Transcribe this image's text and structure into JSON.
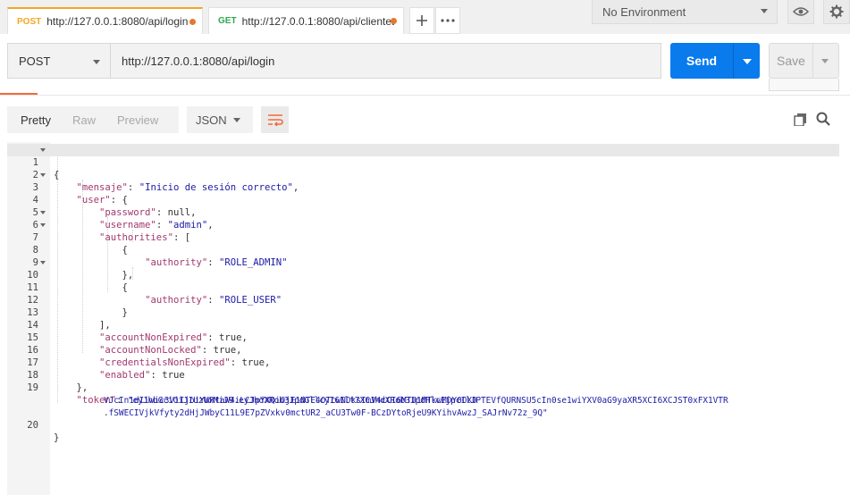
{
  "tabs": [
    {
      "method": "POST",
      "method_color": "#f5a623",
      "url": "http://127.0.0.1:8080/api/login",
      "active": true,
      "unsaved": true
    },
    {
      "method": "GET",
      "method_color": "#2fa84f",
      "url": "http://127.0.0.1:8080/api/clientes",
      "active": false,
      "unsaved": true
    }
  ],
  "tab_actions": {
    "add_icon": "plus-icon",
    "more_icon": "ellipsis-icon"
  },
  "environment": {
    "selected": "No Environment",
    "eye_icon": "eye-icon",
    "settings_icon": "gear-icon"
  },
  "request": {
    "method": "POST",
    "url": "http://127.0.0.1:8080/api/login",
    "send_label": "Send",
    "save_label": "Save"
  },
  "response": {
    "view_tabs": [
      "Pretty",
      "Raw",
      "Preview"
    ],
    "active_view": "Pretty",
    "format": "JSON",
    "code_lines": [
      "{",
      "    \"mensaje\": \"Inicio de sesión correcto\",",
      "    \"user\": {",
      "        \"password\": null,",
      "        \"username\": \"admin\",",
      "        \"authorities\": [",
      "            {",
      "                \"authority\": \"ROLE_ADMIN\"",
      "            },",
      "            {",
      "                \"authority\": \"ROLE_USER\"",
      "            }",
      "        ],",
      "        \"accountNonExpired\": true,",
      "        \"accountNonLocked\": true,",
      "        \"credentialsNonExpired\": true,",
      "        \"enabled\": true",
      "    },",
      "    \"token\": \"eyJhbGciOiJIUzUxMiJ9.eyJhdXRob3JpdGllcyI6Ilt7XCJhdXRob3JpdHlcIjpcIlJPTEVfQURNSU5cIn0se1wiYXV0aG9yaXR5XCI6XCJST0xFX1VTRVJcIn1dIiwic3ViIjoiYWRtaW4iLCJpYXQiOjE1NTE4OTcwNDksImV4cCI6MTU1MTkwMDY0OX0.fSWECIVjkVfyty2dHjJWbyC11L9E7pZVxkv0mctUR2_aCU3Tw0F-BCzDYtoRjeU9KYihvAwzJ_SAJrNv72z_9Q\"",
      "}"
    ],
    "token_wrap": [
      "\"eyJhbGciOiJIUzUxMiJ9.eyJhdXRob3JpdGllcyI6Ilt7XCJhdXRob3JpdHlcIjpcIlJPTEVfQURNSU5cIn0se1wiYXV0aG9yaXR5XCI6XCJST0xFX1VTR",
      "VJcIn1dIiwic3ViIjoiYWRtaW4iLCJpYXQiOjE1NTE4OTcwNDksImV4cCI6MTU1MTkwMDY0OX0",
      ".fSWECIVjkVfyty2dHjJWbyC11L9E7pZVxkv0mctUR2_aCU3Tw0F-BCzDYtoRjeU9KYihvAwzJ_SAJrNv72z_9Q\""
    ],
    "copy_icon": "copy-icon",
    "search_icon": "search-icon",
    "wrap_icon": "word-wrap-icon"
  }
}
